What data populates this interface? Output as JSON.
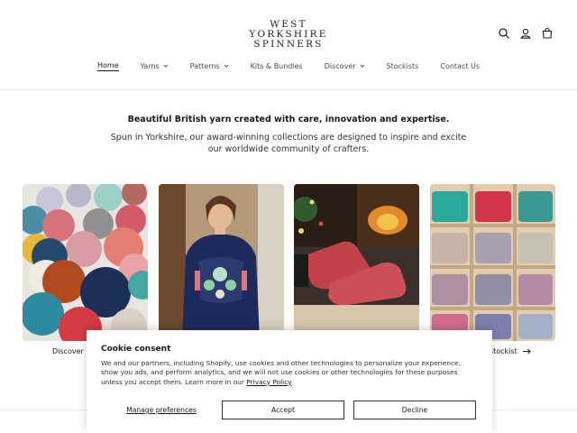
{
  "brand": {
    "logo_lines": [
      "WEST",
      "YORKSHIRE",
      "SPINNERS"
    ]
  },
  "header_icons": [
    "search-icon",
    "account-icon",
    "cart-icon"
  ],
  "nav": {
    "items": [
      {
        "label": "Home",
        "has_dropdown": false,
        "active": true
      },
      {
        "label": "Yarns",
        "has_dropdown": true
      },
      {
        "label": "Patterns",
        "has_dropdown": true
      },
      {
        "label": "Kits & Bundles",
        "has_dropdown": false
      },
      {
        "label": "Discover",
        "has_dropdown": true
      },
      {
        "label": "Stockists",
        "has_dropdown": false
      },
      {
        "label": "Contact Us",
        "has_dropdown": false
      }
    ]
  },
  "hero": {
    "title": "Beautiful British yarn created with care, innovation and expertise.",
    "subtitle": "Spun in Yorkshire, our award-winning collections are designed to inspire and excite our worldwide community of crafters."
  },
  "cards": [
    {
      "label": "Discover O"
    },
    {
      "label": ""
    },
    {
      "label": ""
    },
    {
      "label": "Stockist"
    }
  ],
  "cookie": {
    "title": "Cookie consent",
    "body": "We and our partners, including Shopify, use cookies and other technologies to personalize your experience, show you ads, and perform analytics, and we will not use cookies or other technologies for these purposes unless you accept them. Learn more in our ",
    "link": "Privacy Policy",
    "manage": "Manage preferences",
    "accept": "Accept",
    "decline": "Decline"
  },
  "colors": {
    "text": "#1a1a1a",
    "border": "#333333",
    "divider": "#ececec"
  }
}
